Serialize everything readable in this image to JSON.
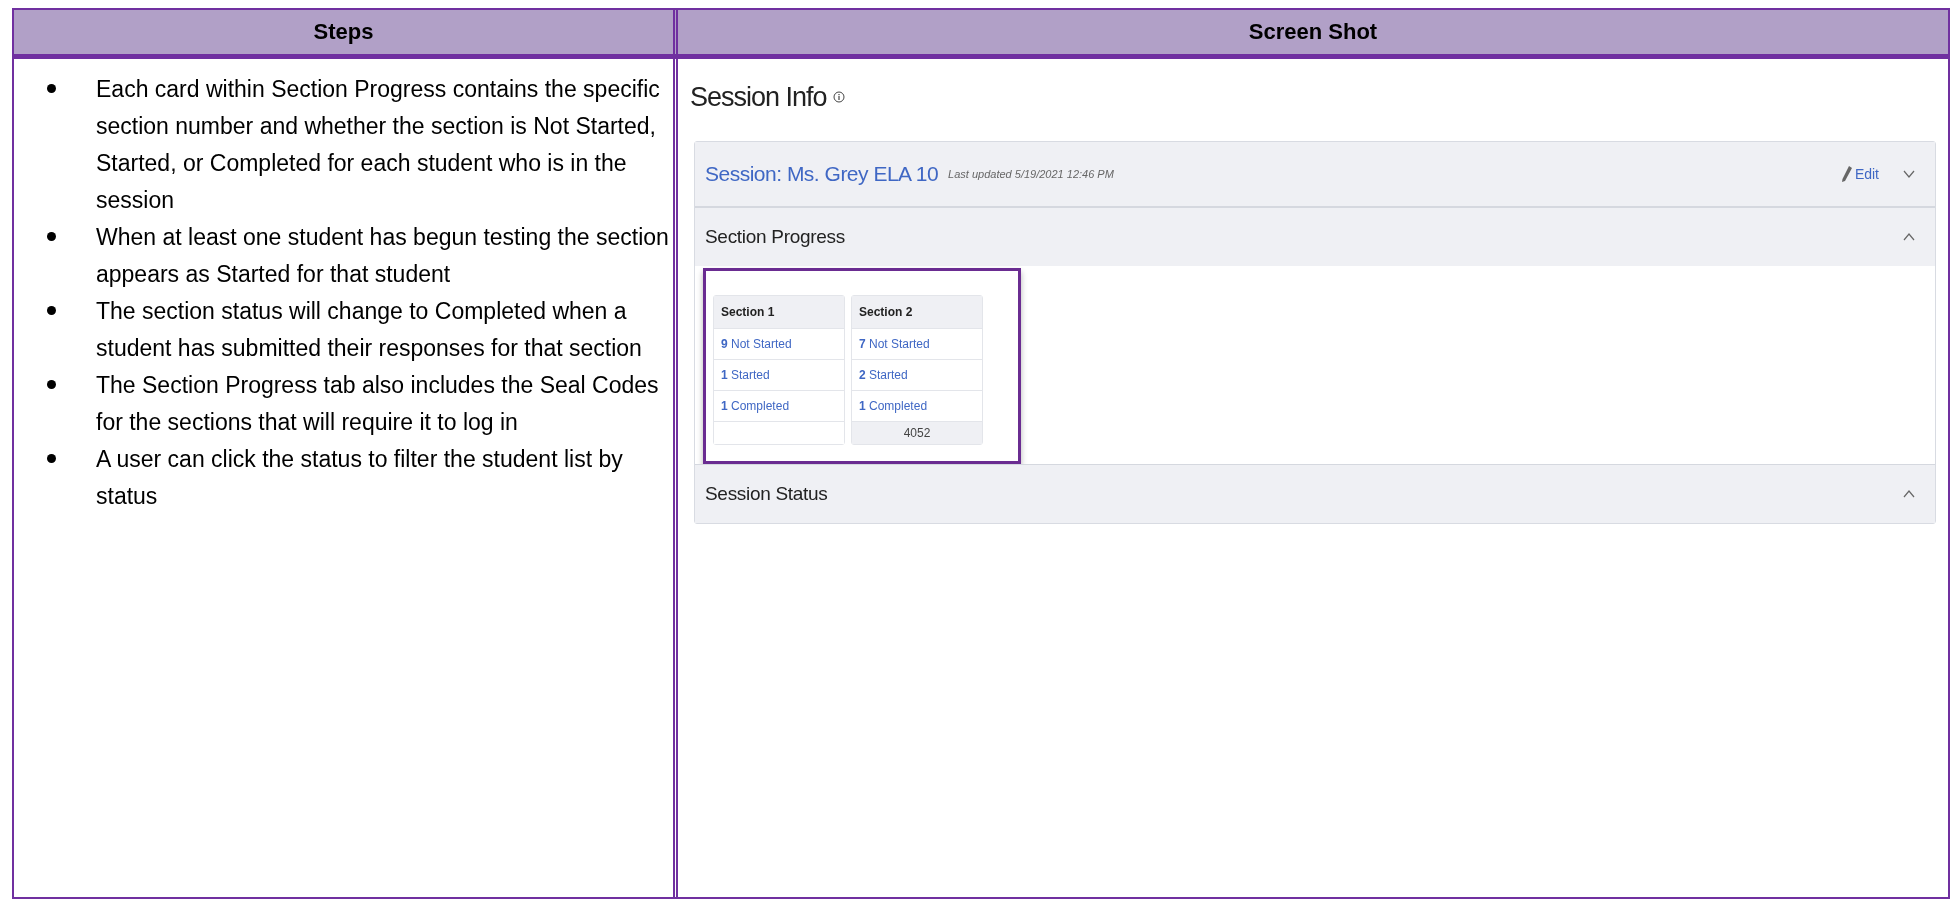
{
  "table": {
    "columns": [
      "Steps",
      "Screen Shot"
    ],
    "steps": [
      "Each card within Section Progress contains the specific section number and whether the section is Not Started, Started, or Completed for each student who is in the session",
      "When at least one student has begun testing the section appears as Started for that student",
      "The section status will change to Completed when a student has submitted their responses for that section",
      "The Section Progress tab also includes the Seal Codes for the sections that will require it to log in",
      "A user can click the status to filter the student list by status"
    ],
    "screenshot": {
      "title": "Session Info",
      "session": {
        "name": "Session: Ms. Grey ELA 10",
        "updated": "Last updated 5/19/2021 12:46 PM",
        "edit": "Edit",
        "expanded": false
      },
      "panels": [
        {
          "kind": "progress",
          "title": "Section Progress",
          "expanded": true,
          "cards": [
            {
              "title": "Section 1",
              "statuses": [
                "**9** Not Started",
                "**1** Started",
                "**1** Completed"
              ]
            },
            {
              "title": "Section 2",
              "statuses": [
                "**7** Not Started",
                "**2** Started",
                "**1** Completed"
              ],
              "seal_code": "4052"
            }
          ]
        },
        {
          "kind": "status",
          "title": "Session Status",
          "expanded": true
        }
      ]
    }
  }
}
